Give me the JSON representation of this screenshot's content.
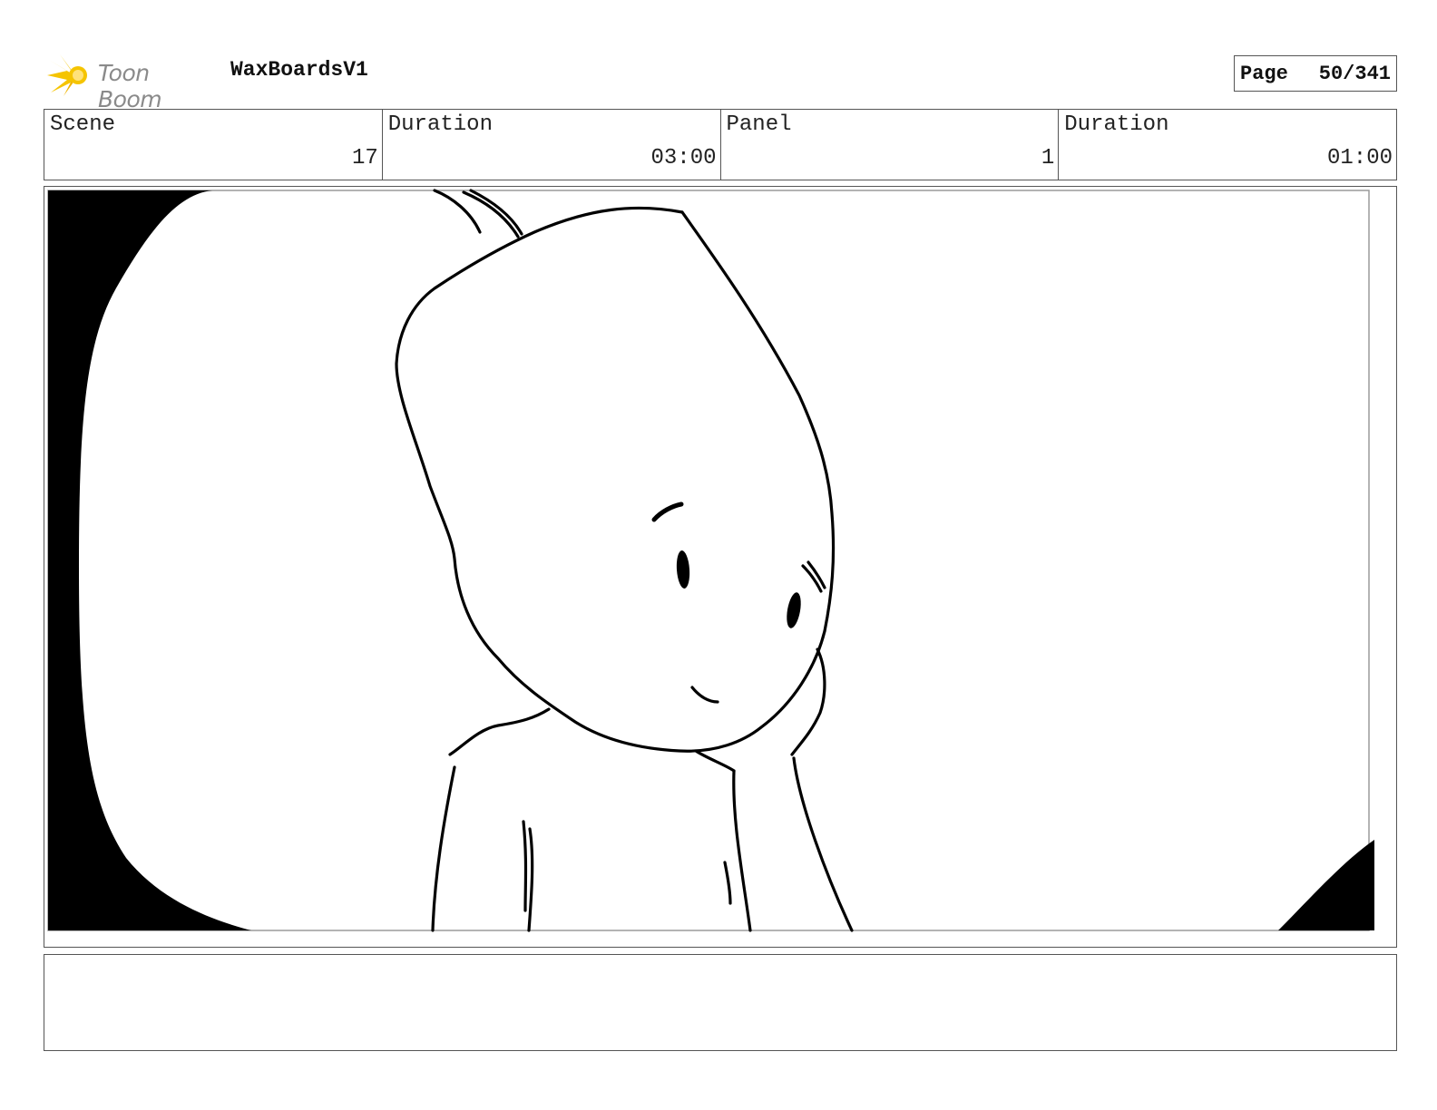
{
  "header": {
    "logo_text": "Toon Boom",
    "project_name": "WaxBoardsV1",
    "page_label": "Page",
    "page_value": "50/341"
  },
  "info": {
    "scene_label": "Scene",
    "scene_value": "17",
    "scene_duration_label": "Duration",
    "scene_duration_value": "03:00",
    "panel_label": "Panel",
    "panel_value": "1",
    "panel_duration_label": "Duration",
    "panel_duration_value": "01:00"
  },
  "panel": {
    "illustration": "sketch-character-leaning-head-on-hand-icon"
  },
  "notes": {
    "text": ""
  },
  "colors": {
    "logo_accent": "#f5c400",
    "frame_border": "#555555",
    "ink": "#000000"
  }
}
